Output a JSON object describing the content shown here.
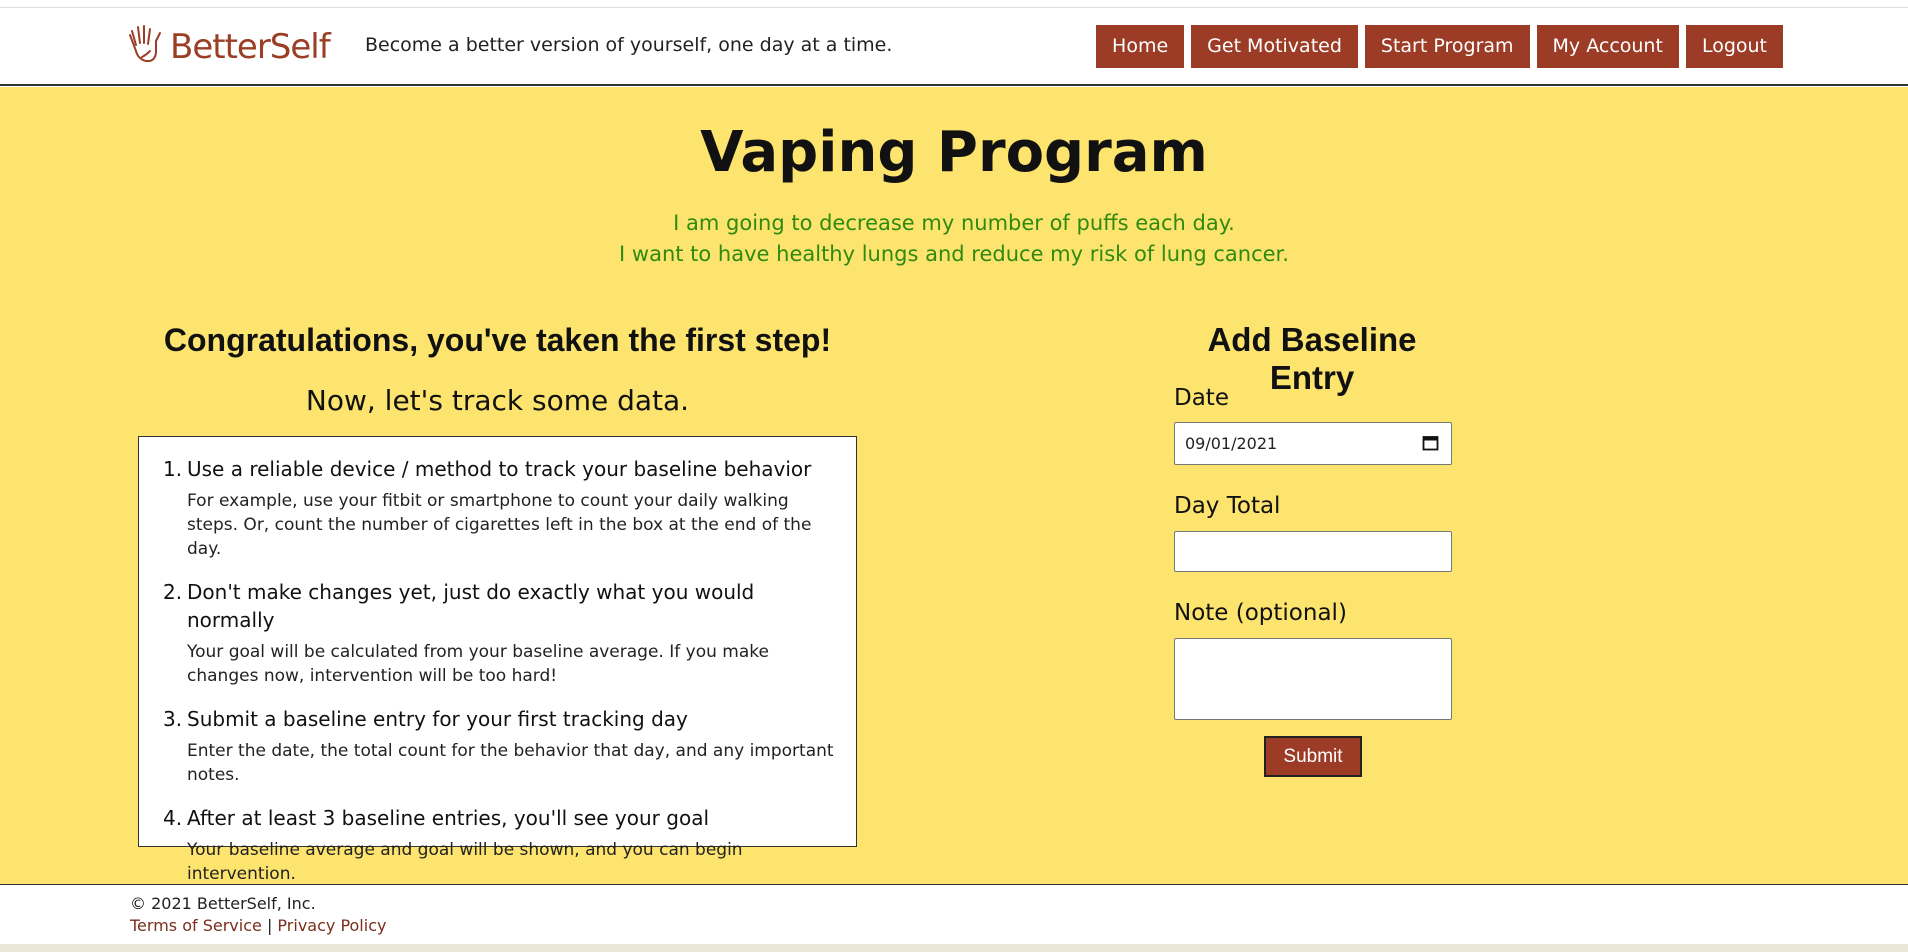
{
  "brand": {
    "name": "BetterSelf",
    "tagline": "Become a better version of yourself, one day at a time."
  },
  "nav": [
    {
      "label": "Home"
    },
    {
      "label": "Get Motivated"
    },
    {
      "label": "Start Program"
    },
    {
      "label": "My Account"
    },
    {
      "label": "Logout"
    }
  ],
  "program": {
    "title": "Vaping Program",
    "goal_lines": [
      "I am going to decrease my number of puffs each day.",
      "I want to have healthy lungs and reduce my risk of lung cancer."
    ]
  },
  "intro": {
    "heading": "Congratulations, you've taken the first step!",
    "subheading": "Now, let's track some data."
  },
  "steps": [
    {
      "num": "1.",
      "title": "Use a reliable device / method to track your baseline behavior",
      "desc": "For example, use your fitbit or smartphone to count your daily walking steps. Or, count the number of cigarettes left in the box at the end of the day."
    },
    {
      "num": "2.",
      "title": "Don't make changes yet, just do exactly what you would normally",
      "desc": "Your goal will be calculated from your baseline average. If you make changes now, intervention will be too hard!"
    },
    {
      "num": "3.",
      "title": "Submit a baseline entry for your first tracking day",
      "desc": "Enter the date, the total count for the behavior that day, and any important notes."
    },
    {
      "num": "4.",
      "title": "After at least 3 baseline entries, you'll see your goal",
      "desc": "Your baseline average and goal will be shown, and you can begin intervention."
    }
  ],
  "form": {
    "title": "Add Baseline Entry",
    "date_label": "Date",
    "date_value": "09/01/2021",
    "total_label": "Day Total",
    "total_value": "",
    "note_label": "Note (optional)",
    "note_value": "",
    "submit_label": "Submit"
  },
  "footer": {
    "copyright": "© 2021 BetterSelf, Inc.",
    "terms": "Terms of Service",
    "separator": "|",
    "privacy": "Privacy Policy"
  },
  "colors": {
    "accent": "#9c3c27",
    "background": "#fde46e",
    "goal_text": "#2e8a10"
  },
  "icons": {
    "logo": "hands-icon",
    "date_picker": "calendar-icon"
  }
}
